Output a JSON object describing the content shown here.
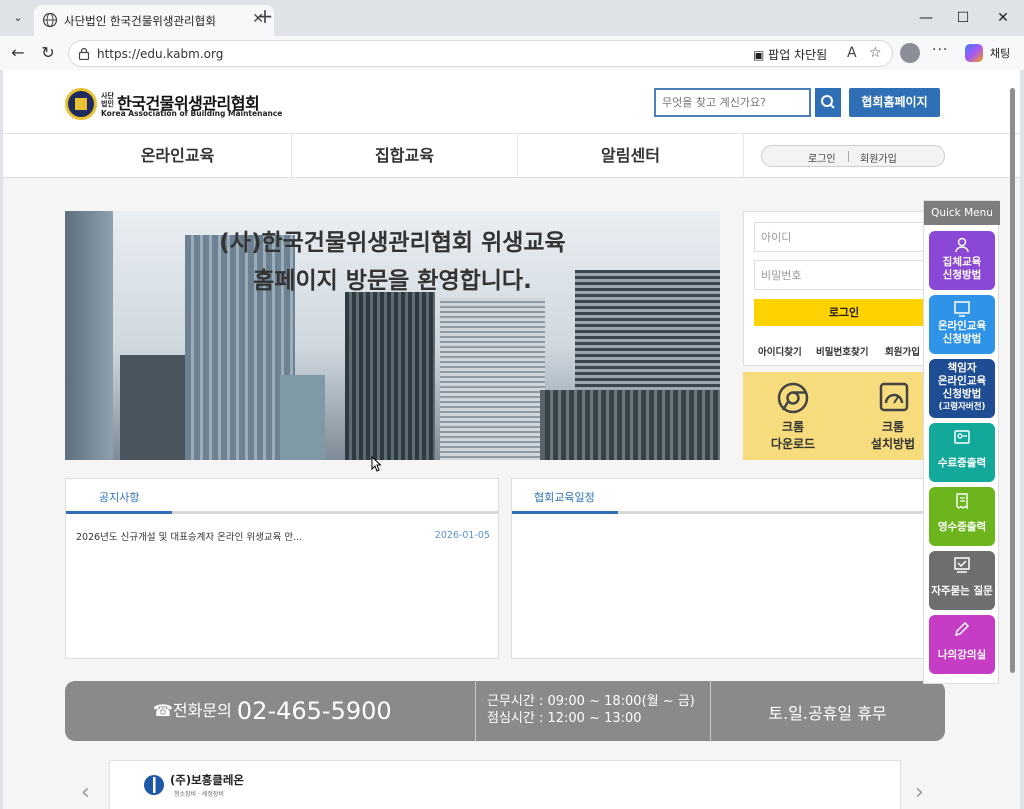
{
  "browser": {
    "tab_title": "사단법인 한국건물위생관리협회",
    "url": "https://edu.kabm.org",
    "popup_blocked": "팝업 차단됨",
    "chat_label": "채팅"
  },
  "header": {
    "logo_small": "사단\n법인",
    "logo_ko": "한국건물위생관리협회",
    "logo_en": "Korea Association of Building Maintenance",
    "search_placeholder": "무엇을 찾고 계신가요?",
    "home_button": "협회홈페이지"
  },
  "nav": {
    "items": [
      "온라인교육",
      "집합교육",
      "알림센터"
    ],
    "login": "로그인",
    "join": "회원가입"
  },
  "banner": {
    "line1": "(사)한국건물위생관리협회 위생교육",
    "line2": "홈페이지 방문을 환영합니다."
  },
  "login": {
    "id_placeholder": "아이디",
    "pw_placeholder": "비밀번호",
    "button": "로그인",
    "find_id": "아이디찾기",
    "find_pw": "비밀번호찾기",
    "join": "회원가입"
  },
  "chrome": {
    "download_1": "크롬",
    "download_2": "다운로드",
    "install_1": "크롬",
    "install_2": "설치방법"
  },
  "notice": {
    "title": "공지사항",
    "items": [
      {
        "title": "2026년도 신규개설 및 대표승계자 온라인 위생교육 안...",
        "date": "2026-01-05"
      }
    ]
  },
  "schedule": {
    "title": "협회교육일정"
  },
  "contact": {
    "phone_label": "☎전화문의",
    "phone": "02-465-5900",
    "hours_1": "근무시간 : 09:00 ~ 18:00(월 ~ 금)",
    "hours_2": "점심시간 : 12:00 ~ 13:00",
    "holiday": "토.일.공휴일 휴무"
  },
  "partner": {
    "name": "(주)보흥클레온",
    "sub": "청소장비 · 세정장비"
  },
  "quick_menu": {
    "title": "Quick Menu",
    "items": [
      {
        "line1": "집체교육",
        "line2": "신청방법",
        "sub": "",
        "color": "#8b47d6",
        "icon": "person-icon"
      },
      {
        "line1": "온라인교육",
        "line2": "신청방법",
        "sub": "",
        "color": "#2f93e8",
        "icon": "monitor-icon"
      },
      {
        "line1": "책임자",
        "line2": "온라인교육",
        "line3": "신청방법",
        "sub": "(고령자버전)",
        "color": "#1f4d93",
        "icon": ""
      },
      {
        "line1": "수료증출력",
        "line2": "",
        "sub": "",
        "color": "#12a89a",
        "icon": "certificate-icon"
      },
      {
        "line1": "영수증출력",
        "line2": "",
        "sub": "",
        "color": "#6cb51d",
        "icon": "receipt-icon"
      },
      {
        "line1": "자주묻는 질문",
        "line2": "",
        "sub": "",
        "color": "#6e6e6e",
        "icon": "faq-icon"
      },
      {
        "line1": "나의강의실",
        "line2": "",
        "sub": "",
        "color": "#c63cc5",
        "icon": "pencil-icon"
      }
    ]
  }
}
